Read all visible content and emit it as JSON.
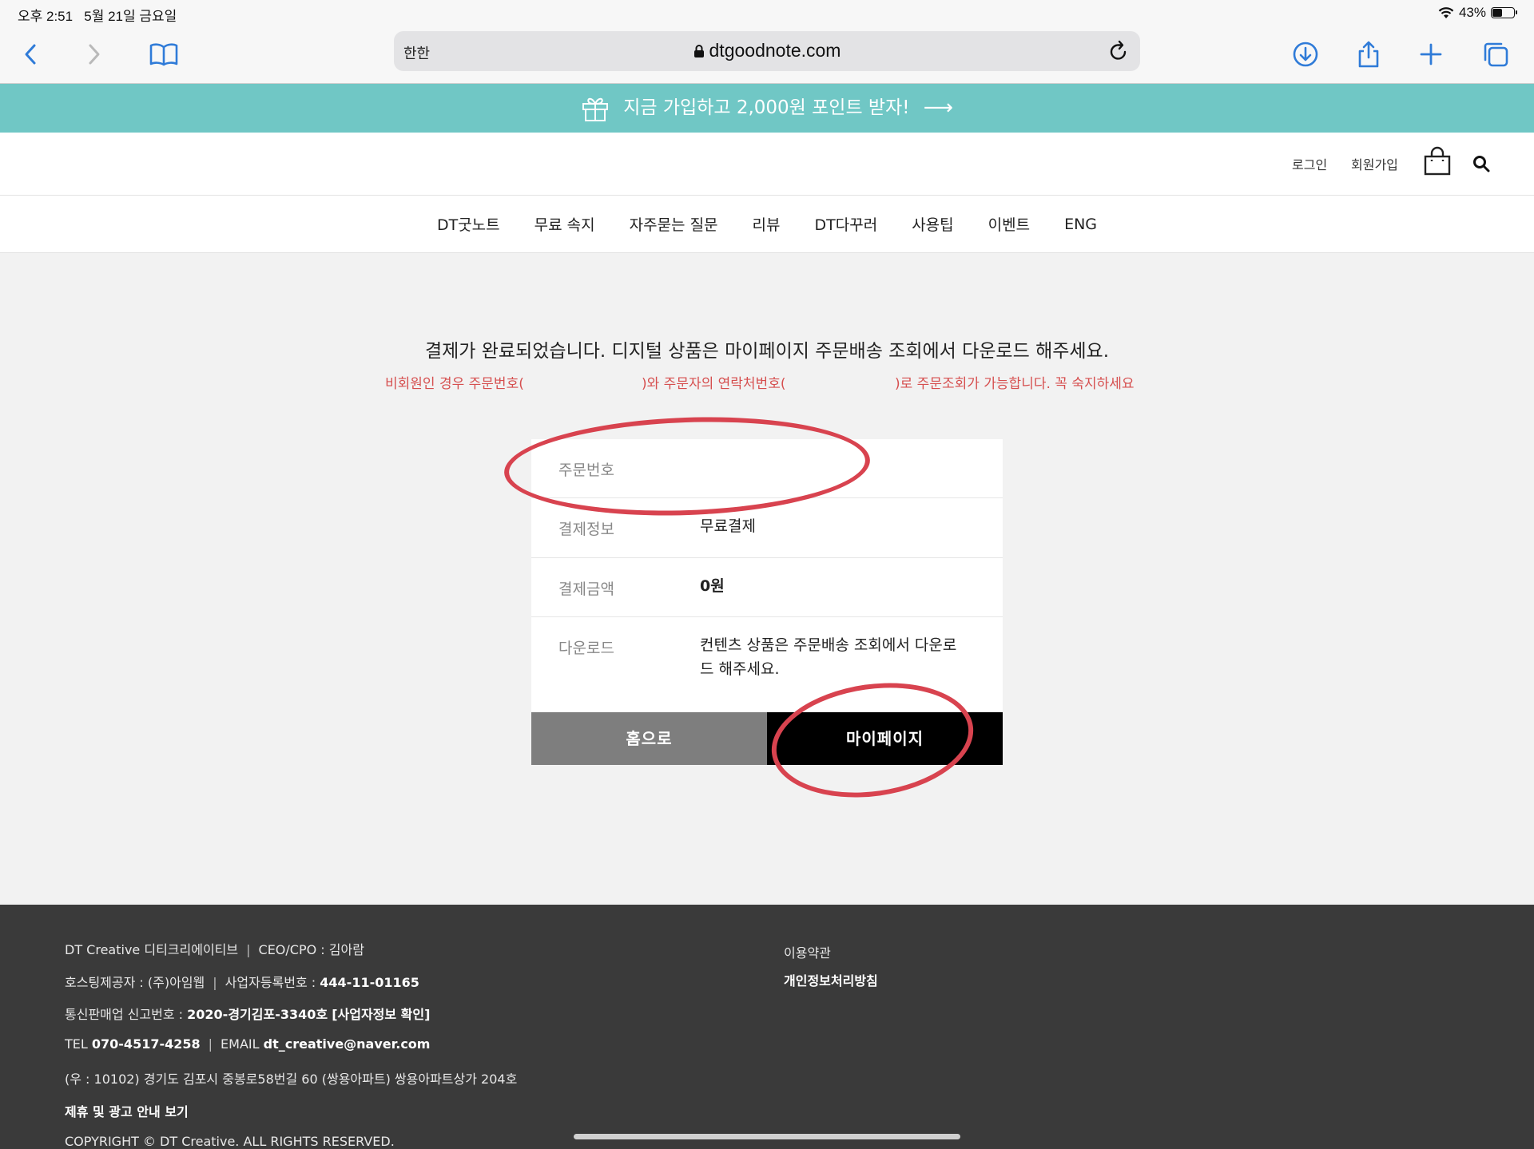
{
  "status_bar": {
    "time": "오후 2:51",
    "date": "5월 21일 금요일",
    "battery": "43%",
    "battery_level": 0.43
  },
  "browser": {
    "lang_label": "한한",
    "host": "dtgoodnote.com"
  },
  "promo": {
    "text": "지금 가입하고 2,000원 포인트 받자!",
    "arrow": "⟶"
  },
  "header": {
    "login": "로그인",
    "signup": "회원가입"
  },
  "nav": {
    "items": [
      "DT굿노트",
      "무료 속지",
      "자주묻는 질문",
      "리뷰",
      "DT다꾸러",
      "사용팁",
      "이벤트",
      "ENG"
    ]
  },
  "content": {
    "complete_message": "결제가 완료되었습니다. 디지털 상품은 마이페이지 주문배송 조회에서 다운로드 해주세요.",
    "notice_part1": "비회원인 경우 주문번호(",
    "notice_part2": ")와 주문자의 연락처번호(",
    "notice_part3": ")로 주문조회가 가능합니다. 꼭 숙지하세요",
    "rows": [
      {
        "label": "주문번호",
        "value": ""
      },
      {
        "label": "결제정보",
        "value": "무료결제"
      },
      {
        "label": "결제금액",
        "value": "0원"
      },
      {
        "label": "다운로드",
        "value_line1": "컨텐츠 상품은 주문배송 조회에서 다운로",
        "value_line2": "드 해주세요."
      }
    ],
    "btn_home": "홈으로",
    "btn_mypage": "마이페이지"
  },
  "colors": {
    "promo": "#70c7c5",
    "notice": "#d64f4f",
    "annotation": "#d8434f",
    "footer_bg": "#3a3a3a"
  },
  "footer": {
    "company_name": "DT Creative",
    "company_kr": "디티크리에이티브",
    "ceo_label": "CEO/CPO :",
    "ceo_name": "김아람",
    "hosting_label": "호스팅제공자 :",
    "hosting_value": "(주)아임웹",
    "biz_label": "사업자등록번호 :",
    "biz_value": "444-11-01165",
    "mail_order_label": "통신판매업 신고번호 :",
    "mail_order_value": "2020-경기김포-3340호",
    "biz_check": "[사업자정보 확인]",
    "tel_label": "TEL",
    "tel_value": "070-4517-4258",
    "email_label": "EMAIL",
    "email_value": "dt_creative@naver.com",
    "address": "(우 : 10102) 경기도 김포시 중봉로58번길 60 (쌍용아파트) 쌍용아파트상가 204호",
    "partnership": "제휴 및 광고 안내 보기",
    "copyright": "COPYRIGHT © DT Creative. ALL RIGHTS RESERVED.",
    "terms": "이용약관",
    "privacy": "개인정보처리방침"
  }
}
